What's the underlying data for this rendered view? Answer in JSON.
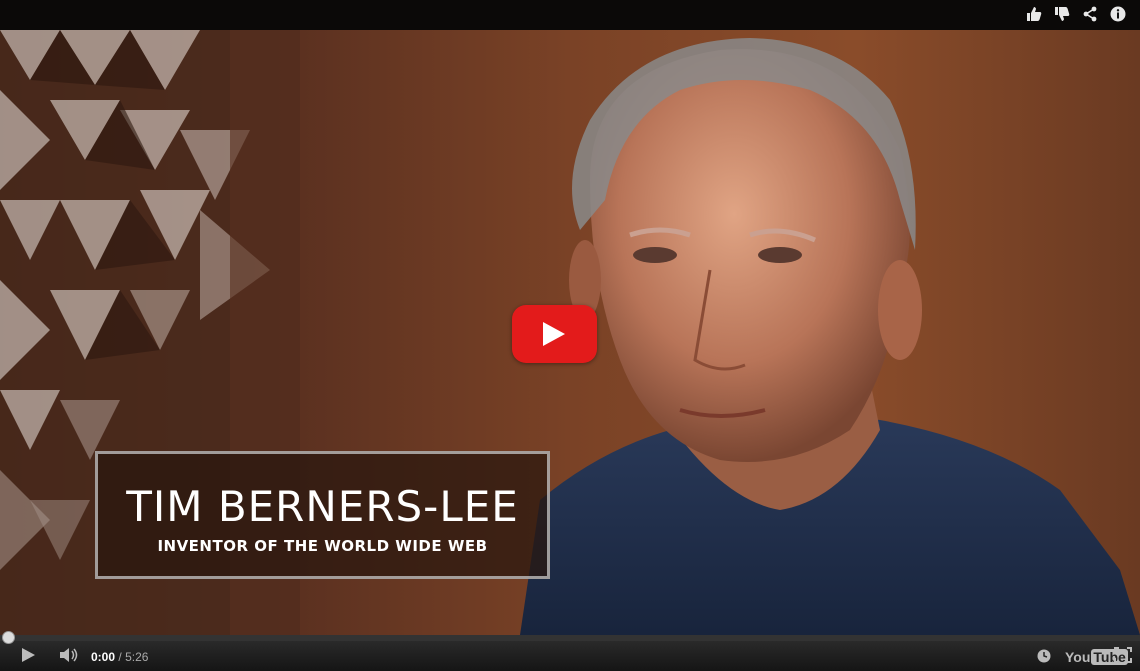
{
  "top_actions": [
    {
      "name": "like-icon"
    },
    {
      "name": "dislike-icon"
    },
    {
      "name": "share-icon"
    },
    {
      "name": "info-icon"
    }
  ],
  "lower_third": {
    "name": "TIM BERNERS-LEE",
    "subtitle": "INVENTOR OF THE WORLD WIDE WEB"
  },
  "controls": {
    "current_time": "0:00",
    "separator": "/",
    "duration": "5:26",
    "progress_fraction": 0.0,
    "logo_you": "You",
    "logo_tube": "Tube"
  },
  "colors": {
    "play_button": "#e31b1b",
    "progress": "#cc0000"
  }
}
